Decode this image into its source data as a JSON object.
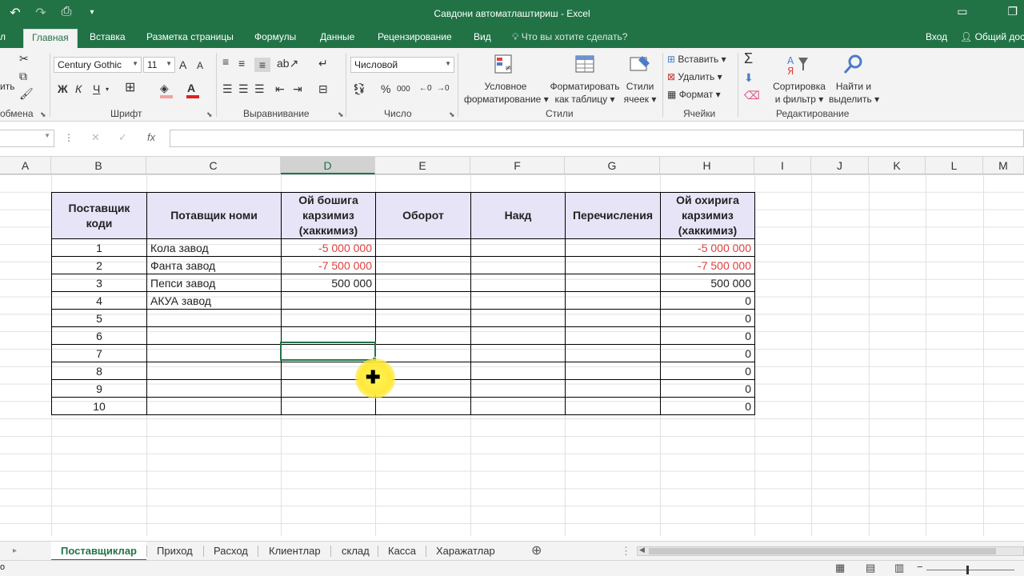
{
  "window": {
    "title": "Савдони автоматлаштириш - Excel",
    "icons": [
      "undo-icon",
      "redo-icon",
      "print-preview-icon",
      "customize-qat-icon",
      "ribbon-display-icon",
      "restore-icon"
    ]
  },
  "menu": {
    "tabs": [
      {
        "label": "л"
      },
      {
        "label": "Главная"
      },
      {
        "label": "Вставка"
      },
      {
        "label": "Разметка страницы"
      },
      {
        "label": "Формулы"
      },
      {
        "label": "Данные"
      },
      {
        "label": "Рецензирование"
      },
      {
        "label": "Вид"
      }
    ],
    "tell_me": "Что вы хотите сделать?",
    "sign_in": "Вход",
    "share": "Общий дос"
  },
  "ribbon": {
    "clipboard": {
      "cut_label": "...",
      "paste_label": "ить",
      "group_label": "обмена"
    },
    "font": {
      "name": "Century Gothic",
      "size": "11",
      "bold": "Ж",
      "italic": "К",
      "underline": "Ч",
      "grow": "A",
      "shrink": "A",
      "group_label": "Шрифт",
      "font_color": "#e02020",
      "fill_color": "#f4a0a0"
    },
    "alignment": {
      "group_label": "Выравнивание"
    },
    "number": {
      "format": "Числовой",
      "percent": "%",
      "thousands": "000",
      "group_label": "Число"
    },
    "styles": {
      "conditional": "Условное",
      "conditional2": "форматирование",
      "table": "Форматировать",
      "table2": "как таблицу",
      "cell_styles": "Стили",
      "cell_styles2": "ячеек",
      "group_label": "Стили"
    },
    "cells": {
      "insert": "Вставить",
      "delete": "Удалить",
      "format": "Формат",
      "group_label": "Ячейки"
    },
    "editing": {
      "sort": "Сортировка",
      "sort2": "и фильтр",
      "find": "Найти и",
      "find2": "выделить",
      "group_label": "Редактирование"
    }
  },
  "formula_bar": {
    "cancel": "✕",
    "enter": "✓",
    "fx": "fx",
    "value": ""
  },
  "columns": [
    "A",
    "B",
    "C",
    "D",
    "E",
    "F",
    "G",
    "H",
    "I",
    "J",
    "K",
    "L",
    "M"
  ],
  "selected_column": "D",
  "table": {
    "headers": [
      "Поставщик коди",
      "Потавщик номи",
      "Ой бошига карзимиз (хаккимиз)",
      "Оборот",
      "Накд",
      "Перечисления",
      "Ой охирига карзимиз (хаккимиз)"
    ],
    "rows": [
      {
        "code": "1",
        "name": "Кола завод",
        "start": "-5 000 000",
        "turnover": "",
        "cash": "",
        "transfer": "",
        "end": "-5 000 000"
      },
      {
        "code": "2",
        "name": "Фанта завод",
        "start": "-7 500 000",
        "turnover": "",
        "cash": "",
        "transfer": "",
        "end": "-7 500 000"
      },
      {
        "code": "3",
        "name": "Пепси завод",
        "start": "500 000",
        "turnover": "",
        "cash": "",
        "transfer": "",
        "end": "500 000"
      },
      {
        "code": "4",
        "name": "АКУА завод",
        "start": "",
        "turnover": "",
        "cash": "",
        "transfer": "",
        "end": "0"
      },
      {
        "code": "5",
        "name": "",
        "start": "",
        "turnover": "",
        "cash": "",
        "transfer": "",
        "end": "0"
      },
      {
        "code": "6",
        "name": "",
        "start": "",
        "turnover": "",
        "cash": "",
        "transfer": "",
        "end": "0"
      },
      {
        "code": "7",
        "name": "",
        "start": "",
        "turnover": "",
        "cash": "",
        "transfer": "",
        "end": "0"
      },
      {
        "code": "8",
        "name": "",
        "start": "",
        "turnover": "",
        "cash": "",
        "transfer": "",
        "end": "0"
      },
      {
        "code": "9",
        "name": "",
        "start": "",
        "turnover": "",
        "cash": "",
        "transfer": "",
        "end": "0"
      },
      {
        "code": "10",
        "name": "",
        "start": "",
        "turnover": "",
        "cash": "",
        "transfer": "",
        "end": "0"
      }
    ],
    "negative_color": "#e04040",
    "header_fill": "#e8e4f8"
  },
  "sheets": [
    "Поставщиклар",
    "Приход",
    "Расход",
    "Клиентлар",
    "склад",
    "Касса",
    "Харажатлар"
  ],
  "active_sheet": "Поставщиклар",
  "statusbar": {
    "left": "о"
  },
  "accent": "#217346"
}
